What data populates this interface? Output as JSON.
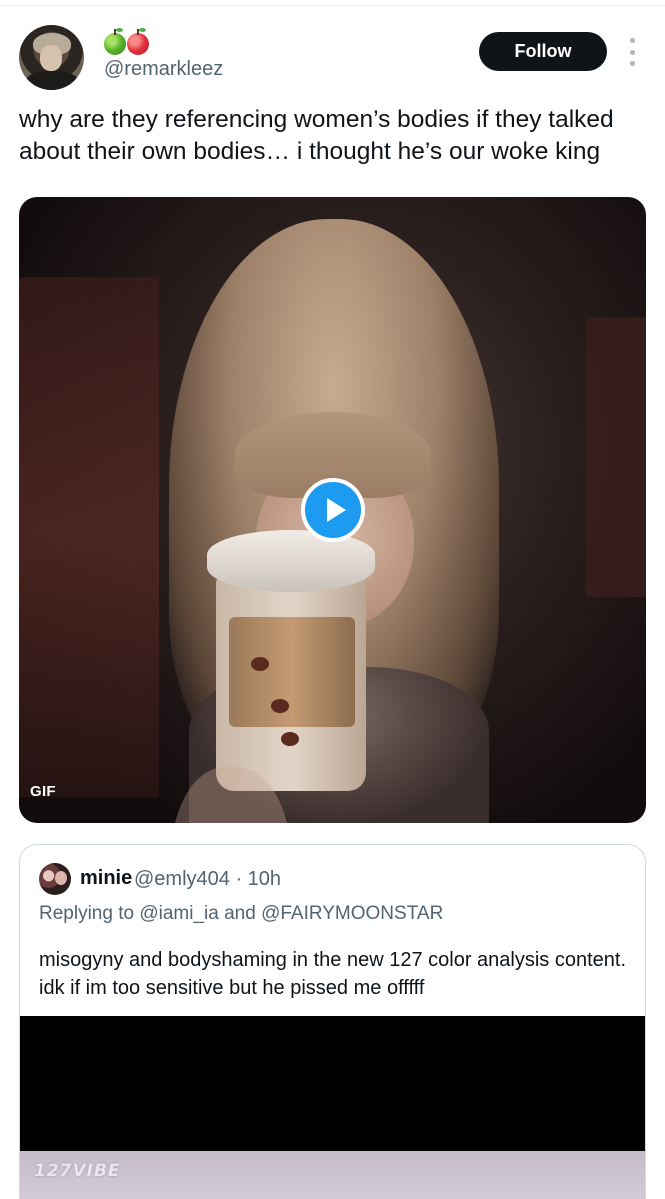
{
  "author": {
    "emoji": [
      "green-apple",
      "red-apple"
    ],
    "handle": "@remarkleez",
    "follow_label": "Follow"
  },
  "tweet": {
    "text": "why are they referencing women’s bodies if they talked about their own bodies… i thought he’s our woke king"
  },
  "media": {
    "badge": "GIF",
    "play_icon": "play-icon"
  },
  "quoted": {
    "name": "minie",
    "meta": "@emly404 · 10h",
    "replying_to": "Replying to @iami_ia and @FAIRYMOONSTAR",
    "text": "misogyny and bodyshaming in the new 127 color analysis content. idk if im too sensitive but he pissed me offfff",
    "media_watermark": "127VIBE"
  },
  "colors": {
    "accent": "#1d9bf0",
    "text_primary": "#0f1419",
    "text_secondary": "#536471",
    "border": "#cfd9de"
  }
}
